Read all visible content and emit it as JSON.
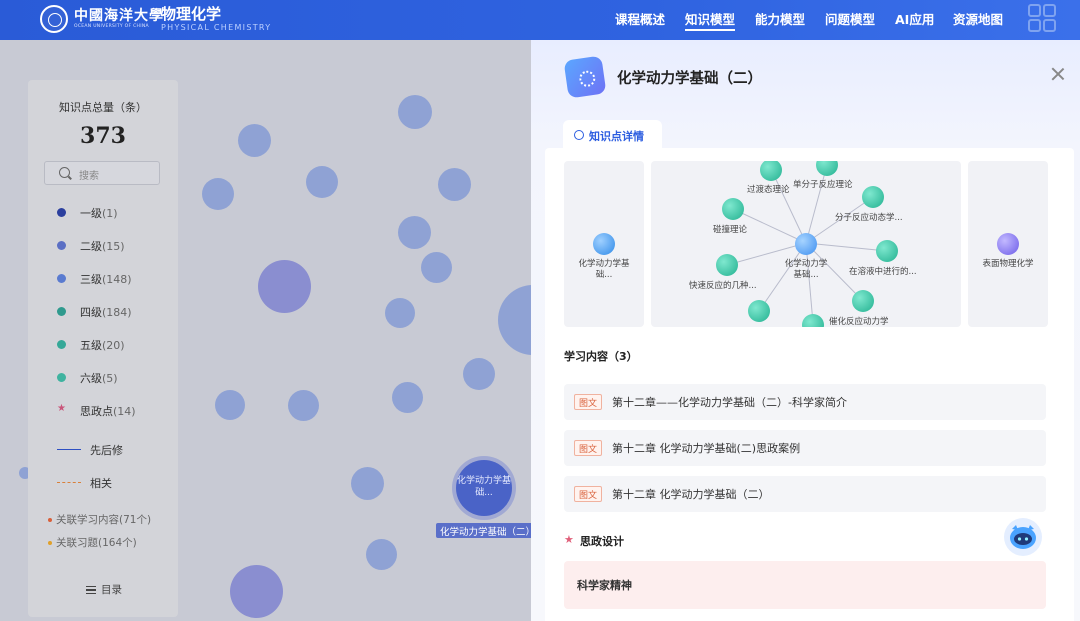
{
  "header": {
    "school_name_cn": "中國海洋大學",
    "school_name_en": "OCEAN UNIVERSITY OF CHINA",
    "course_title": "物理化学",
    "course_subtitle": "PHYSICAL CHEMISTRY",
    "nav": [
      {
        "label": "课程概述",
        "active": false
      },
      {
        "label": "知识模型",
        "active": true
      },
      {
        "label": "能力模型",
        "active": false
      },
      {
        "label": "问题模型",
        "active": false
      },
      {
        "label": "AI应用",
        "active": false
      },
      {
        "label": "资源地图",
        "active": false
      }
    ]
  },
  "left_panel": {
    "total_label": "知识点总量（条）",
    "total_count": "373",
    "search_placeholder": "搜索",
    "levels": [
      {
        "name": "一级",
        "count": "(1)",
        "color": "#2b3f9e"
      },
      {
        "name": "二级",
        "count": "(15)",
        "color": "#5b6fc4"
      },
      {
        "name": "三级",
        "count": "(148)",
        "color": "#5a7bd0"
      },
      {
        "name": "四级",
        "count": "(184)",
        "color": "#2f9a8e"
      },
      {
        "name": "五级",
        "count": "(20)",
        "color": "#35a898"
      },
      {
        "name": "六级",
        "count": "(5)",
        "color": "#3fb3a0"
      },
      {
        "name": "思政点",
        "count": "(14)",
        "color": "#c9557a"
      }
    ],
    "legend_prereq": "先后修",
    "legend_related": "相关",
    "related_content": "关联学习内容(71个)",
    "related_exercises": "关联习题(164个)",
    "toc_label": "目录"
  },
  "background_graph": {
    "selected_node_label": "化学动力学基础...",
    "selected_node_tag": "化学动力学基础（二）"
  },
  "detail_panel": {
    "title": "化学动力学基础（二）",
    "tab_label": "知识点详情",
    "prev_card_label": "化学动力学基础...",
    "next_card_label": "表面物理化学",
    "center_node_label": "化学动力学基础...",
    "graph_nodes": [
      "过渡态理论",
      "单分子反应理论",
      "分子反应动态学...",
      "碰撞理论",
      "在溶液中进行的...",
      "快速反应的几种...",
      "催化反应动力学"
    ],
    "learning_title": "学习内容（3）",
    "learning_items": [
      {
        "tag": "图文",
        "text": "第十二章——化学动力学基础（二）-科学家简介"
      },
      {
        "tag": "图文",
        "text": "第十二章 化学动力学基础(二)思政案例"
      },
      {
        "tag": "图文",
        "text": "第十二章 化学动力学基础（二）"
      }
    ],
    "szdesign_title": "思政设计",
    "szdesign_item": "科学家精神"
  }
}
